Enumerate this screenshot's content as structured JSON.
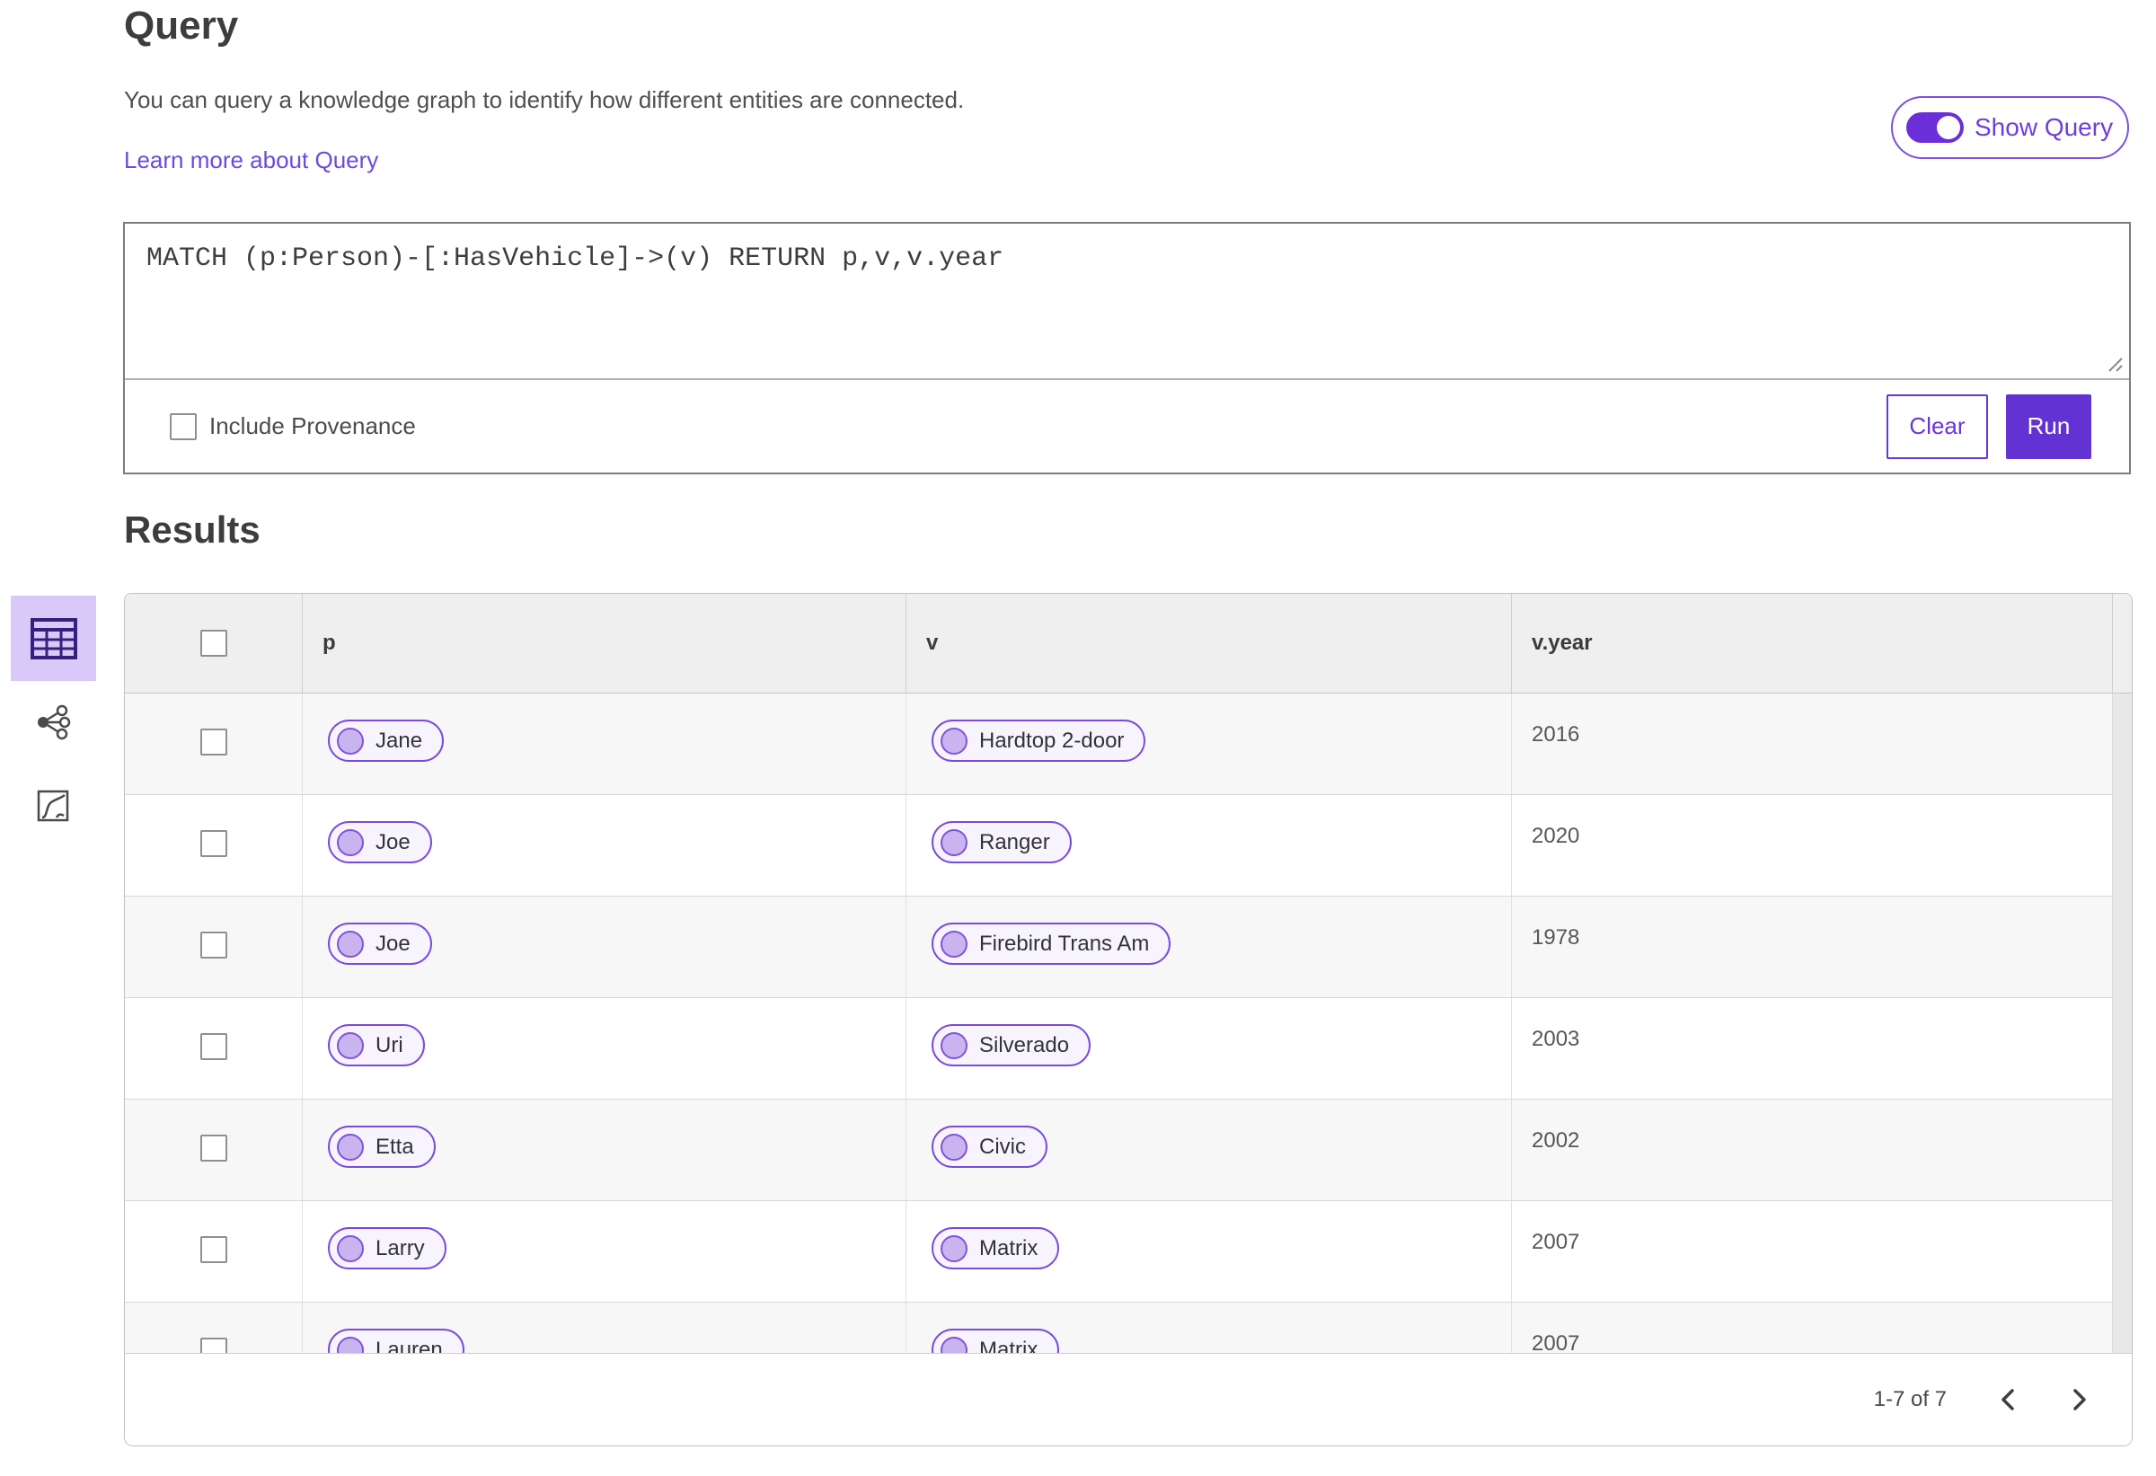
{
  "header": {
    "title": "Query",
    "description": "You can query a knowledge graph to identify how different entities are connected.",
    "learn_more_label": "Learn more about Query",
    "show_query_label": "Show Query",
    "show_query_on": true
  },
  "query_panel": {
    "query_text": "MATCH (p:Person)-[:HasVehicle]->(v) RETURN p,v,v.year",
    "include_provenance_label": "Include Provenance",
    "include_provenance_checked": false,
    "clear_label": "Clear",
    "run_label": "Run"
  },
  "results": {
    "title": "Results",
    "view_switcher": [
      {
        "name": "table-view",
        "icon": "table-icon",
        "selected": true
      },
      {
        "name": "graph-view",
        "icon": "network-icon",
        "selected": false
      },
      {
        "name": "chart-view",
        "icon": "chart-icon",
        "selected": false
      }
    ],
    "table": {
      "columns": [
        "p",
        "v",
        "v.year"
      ],
      "rows": [
        {
          "p": "Jane",
          "v": "Hardtop 2-door",
          "v_year": "2016"
        },
        {
          "p": "Joe",
          "v": "Ranger",
          "v_year": "2020"
        },
        {
          "p": "Joe",
          "v": "Firebird Trans Am",
          "v_year": "1978"
        },
        {
          "p": "Uri",
          "v": "Silverado",
          "v_year": "2003"
        },
        {
          "p": "Etta",
          "v": "Civic",
          "v_year": "2002"
        },
        {
          "p": "Larry",
          "v": "Matrix",
          "v_year": "2007"
        },
        {
          "p": "Lauren",
          "v": "Matrix",
          "v_year": "2007"
        }
      ]
    },
    "pagination": {
      "range_label": "1-7 of 7"
    }
  },
  "colors": {
    "accent_purple": "#6936d6",
    "run_button_bg": "#6233d2",
    "toggle_track": "#6a2fd9",
    "link_purple": "#6a4ae0",
    "pill_border": "#7a4bd9",
    "pill_bg": "#f7f4fe",
    "pill_dot": "#c9b4ef",
    "selected_view_bg": "#d9c9f8",
    "table_header_bg": "#efefef",
    "row_stripe_bg": "#f7f7f7"
  }
}
